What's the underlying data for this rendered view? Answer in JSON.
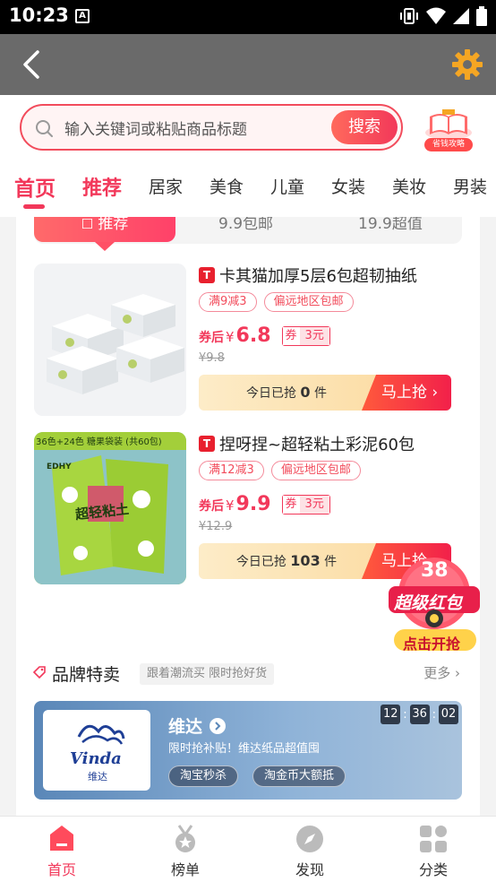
{
  "status_bar": {
    "time": "10:23",
    "notif_glyph": "A"
  },
  "search": {
    "placeholder": "输入关键词或粘贴商品标题",
    "button_label": "搜索",
    "guide_label": "省钱攻略"
  },
  "tabs": [
    "首页",
    "推荐",
    "居家",
    "美食",
    "儿童",
    "女装",
    "美妆",
    "男装"
  ],
  "subtabs": {
    "active": "推荐",
    "items": [
      "9.9包邮",
      "19.9超值"
    ]
  },
  "products": [
    {
      "title": "卡其猫加厚5层6包超韧抽纸",
      "tags": [
        "满9减3",
        "偏远地区包邮"
      ],
      "price_prefix": "券后",
      "currency": "¥",
      "price": "6.8",
      "coupon_key": "券",
      "coupon_value": "3元",
      "original_price": "¥9.8",
      "sold_prefix": "今日已抢",
      "sold_count": "0",
      "sold_suffix": "件",
      "buy_label": "马上抢"
    },
    {
      "title": "捏呀捏~超轻粘土彩泥60包",
      "tags": [
        "满12减3",
        "偏远地区包邮"
      ],
      "price_prefix": "券后",
      "currency": "¥",
      "price": "9.9",
      "coupon_key": "券",
      "coupon_value": "3元",
      "original_price": "¥12.9",
      "sold_prefix": "今日已抢",
      "sold_count": "103",
      "sold_suffix": "件",
      "buy_label": "马上抢",
      "image_badge": "36色+24色 糖果袋装 (共60包)",
      "image_brand": "EDHY",
      "image_text": "超轻粘土"
    }
  ],
  "brand_section": {
    "title": "品牌特卖",
    "subtitle": "跟着潮流买 限时抢好货",
    "more_label": "更多",
    "brand_name": "维达",
    "brand_desc": "限时抢补贴！维达纸品超值囤",
    "chips": [
      "淘宝秒杀",
      "淘金币大额抵"
    ],
    "countdown": [
      "12",
      "36",
      "02"
    ],
    "logo_text": "Vinda",
    "logo_sub": "维达"
  },
  "red_packet": {
    "number": "38",
    "title": "超级红包",
    "action": "点击开抢"
  },
  "bottom_nav": [
    "首页",
    "榜单",
    "发现",
    "分类"
  ],
  "colors": {
    "accent": "#f2385a",
    "header_bg": "#6a6a6a",
    "gear": "#f5a623"
  }
}
